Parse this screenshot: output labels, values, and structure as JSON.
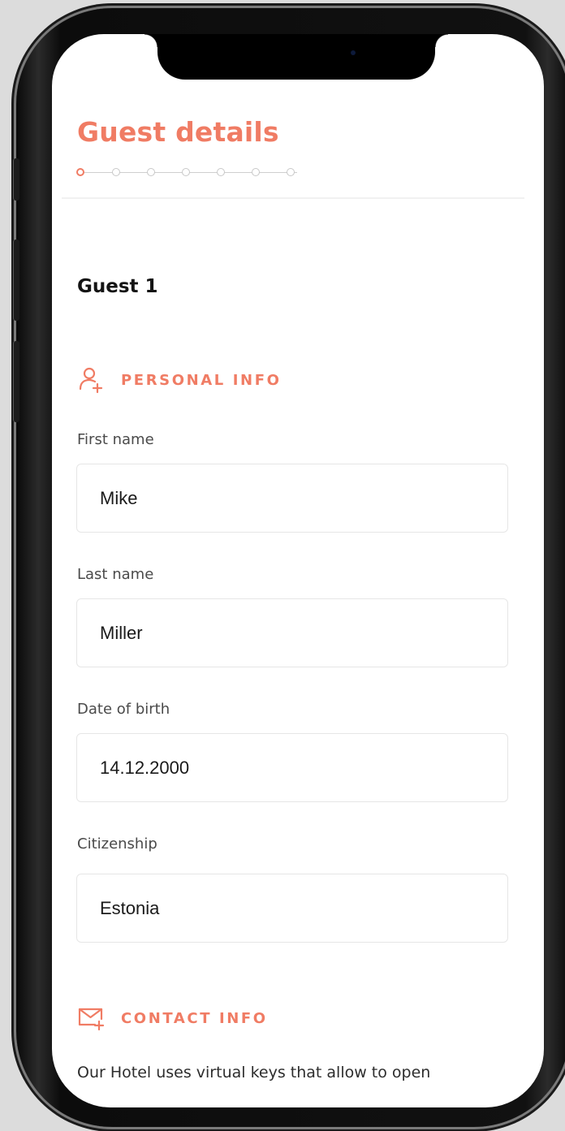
{
  "header": {
    "title": "Guest details",
    "steps": [
      {
        "state": "active"
      },
      {
        "state": "inactive"
      },
      {
        "state": "inactive"
      },
      {
        "state": "inactive"
      },
      {
        "state": "inactive"
      },
      {
        "state": "inactive"
      },
      {
        "state": "inactive"
      }
    ]
  },
  "guest": {
    "title": "Guest 1"
  },
  "personal_info": {
    "label": "PERSONAL INFO",
    "icon": "person-add-icon",
    "fields": {
      "first_name": {
        "label": "First name",
        "value": "Mike"
      },
      "last_name": {
        "label": "Last name",
        "value": "Miller"
      },
      "date_of_birth": {
        "label": "Date of birth",
        "value": "14.12.2000"
      },
      "citizenship": {
        "label": "Citizenship",
        "value": "Estonia"
      }
    }
  },
  "contact_info": {
    "label": "CONTACT INFO",
    "icon": "mail-add-icon",
    "text": "Our Hotel uses virtual keys that allow to open"
  },
  "colors": {
    "accent": "#f07c64",
    "text": "#141414",
    "muted": "#4a4a4a",
    "border": "#e6e6e6"
  }
}
